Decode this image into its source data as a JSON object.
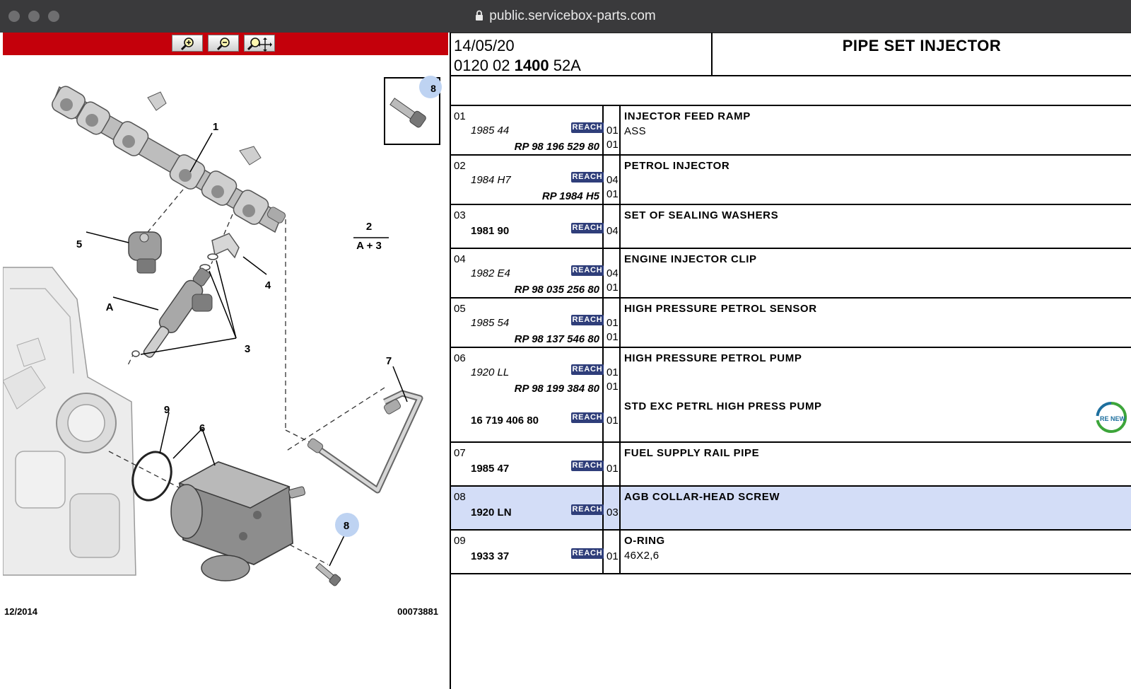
{
  "browser": {
    "url": "public.servicebox-parts.com"
  },
  "diagram": {
    "date_stamp": "12/2014",
    "ref_number": "00073881",
    "callouts": [
      "1",
      "2",
      "A + 3",
      "3",
      "4",
      "5",
      "A",
      "6",
      "7",
      "8",
      "9"
    ],
    "inset_callout": "8"
  },
  "header": {
    "date": "14/05/20",
    "code_prefix": "0120 02 ",
    "code_bold": "1400",
    "code_suffix": " 52A",
    "title": "PIPE SET INJECTOR"
  },
  "badge_label": "REACH",
  "renew_label": "RE NEW",
  "parts": [
    {
      "num": "01",
      "ref": "1985 44",
      "qty": "01",
      "rp": "RP 98 196 529 80",
      "rp_qty": "01",
      "desc": "INJECTOR FEED RAMP",
      "sub": "ASS"
    },
    {
      "num": "02",
      "ref": "1984 H7",
      "qty": "04",
      "rp": "RP 1984 H5",
      "rp_qty": "01",
      "desc": "PETROL INJECTOR"
    },
    {
      "num": "03",
      "ref": "1981 90",
      "qty": "04",
      "desc": "SET OF SEALING WASHERS"
    },
    {
      "num": "04",
      "ref": "1982 E4",
      "qty": "04",
      "rp": "RP 98 035 256 80",
      "rp_qty": "01",
      "desc": "ENGINE INJECTOR CLIP"
    },
    {
      "num": "05",
      "ref": "1985 54",
      "qty": "01",
      "rp": "RP 98 137 546 80",
      "rp_qty": "01",
      "desc": "HIGH PRESSURE PETROL SENSOR"
    },
    {
      "num": "06",
      "ref": "1920 LL",
      "qty": "01",
      "rp": "RP 98 199 384 80",
      "rp_qty": "01",
      "desc": "HIGH PRESSURE PETROL PUMP",
      "ref2": "16 719 406 80",
      "qty2": "01",
      "desc2": "STD EXC PETRL HIGH PRESS PUMP"
    },
    {
      "num": "07",
      "ref": "1985 47",
      "qty": "01",
      "desc": "FUEL SUPPLY RAIL PIPE"
    },
    {
      "num": "08",
      "ref": "1920 LN",
      "qty": "03",
      "desc": "AGB COLLAR-HEAD SCREW"
    },
    {
      "num": "09",
      "ref": "1933 37",
      "qty": "01",
      "desc": "O-RING",
      "sub": "46X2,6"
    }
  ]
}
